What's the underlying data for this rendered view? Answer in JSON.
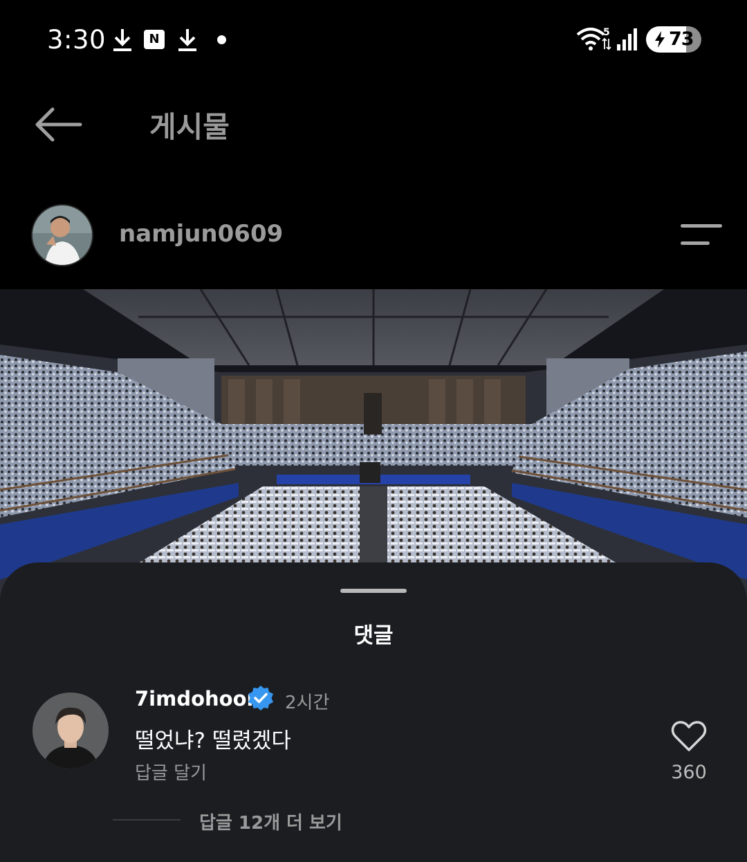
{
  "status_bar": {
    "time": "3:30",
    "icons": [
      "download-icon",
      "naver-icon",
      "download-icon",
      "dot-icon",
      "wifi-icon",
      "signal-icon",
      "battery-icon"
    ],
    "notification_badge": "N",
    "wifi_badge": "5",
    "battery_percent": "73",
    "battery_level": 0.73
  },
  "header": {
    "title": "게시물",
    "back_icon": "arrow-left-icon"
  },
  "post": {
    "username": "namjun0609",
    "menu_icon": "menu-icon"
  },
  "comments": {
    "title": "댓글",
    "items": [
      {
        "username": "7imdohoon",
        "verified": true,
        "time": "2시간",
        "text": "떨었냐? 떨렸겠다",
        "reply_label": "답글 달기",
        "likes": "360"
      }
    ],
    "more_replies": "답글 12개 더 보기"
  },
  "colors": {
    "background": "#000000",
    "sheet": "#1c1d21",
    "verified": "#3797f0",
    "muted_text": "#9a9a9a"
  }
}
